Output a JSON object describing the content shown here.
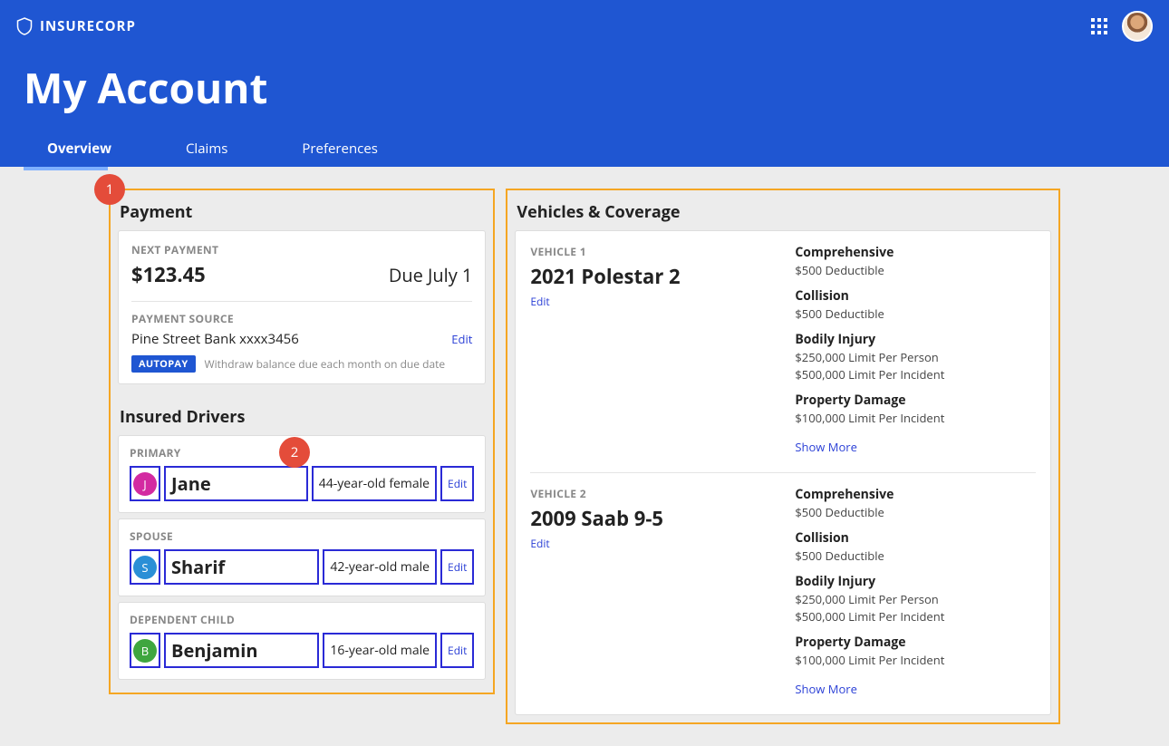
{
  "brand": "INSURECORP",
  "page_title": "My Account",
  "tabs": [
    {
      "label": "Overview",
      "active": true
    },
    {
      "label": "Claims",
      "active": false
    },
    {
      "label": "Preferences",
      "active": false
    }
  ],
  "markers": {
    "one": "1",
    "two": "2"
  },
  "payment": {
    "section_title": "Payment",
    "next_label": "NEXT PAYMENT",
    "amount": "$123.45",
    "due": "Due July 1",
    "source_label": "PAYMENT SOURCE",
    "source_value": "Pine Street Bank xxxx3456",
    "edit": "Edit",
    "autopay_badge": "AUTOPAY",
    "autopay_desc": "Withdraw balance due each month on due date"
  },
  "drivers": {
    "section_title": "Insured Drivers",
    "list": [
      {
        "role": "PRIMARY",
        "initial": "J",
        "color": "j",
        "name": "Jane",
        "desc": "44-year-old female",
        "edit": "Edit"
      },
      {
        "role": "SPOUSE",
        "initial": "S",
        "color": "s",
        "name": "Sharif",
        "desc": "42-year-old male",
        "edit": "Edit"
      },
      {
        "role": "DEPENDENT CHILD",
        "initial": "B",
        "color": "b",
        "name": "Benjamin",
        "desc": "16-year-old male",
        "edit": "Edit"
      }
    ]
  },
  "vehicles": {
    "section_title": "Vehicles & Coverage",
    "list": [
      {
        "label": "VEHICLE 1",
        "name": "2021 Polestar 2",
        "edit": "Edit",
        "coverage": [
          {
            "name": "Comprehensive",
            "details": [
              "$500 Deductible"
            ]
          },
          {
            "name": "Collision",
            "details": [
              "$500 Deductible"
            ]
          },
          {
            "name": "Bodily Injury",
            "details": [
              "$250,000 Limit Per Person",
              "$500,000 Limit Per Incident"
            ]
          },
          {
            "name": "Property Damage",
            "details": [
              "$100,000 Limit Per Incident"
            ]
          }
        ],
        "show_more": "Show More"
      },
      {
        "label": "VEHICLE 2",
        "name": "2009 Saab 9-5",
        "edit": "Edit",
        "coverage": [
          {
            "name": "Comprehensive",
            "details": [
              "$500 Deductible"
            ]
          },
          {
            "name": "Collision",
            "details": [
              "$500 Deductible"
            ]
          },
          {
            "name": "Bodily Injury",
            "details": [
              "$250,000 Limit Per Person",
              "$500,000 Limit Per Incident"
            ]
          },
          {
            "name": "Property Damage",
            "details": [
              "$100,000 Limit Per Incident"
            ]
          }
        ],
        "show_more": "Show More"
      }
    ]
  }
}
